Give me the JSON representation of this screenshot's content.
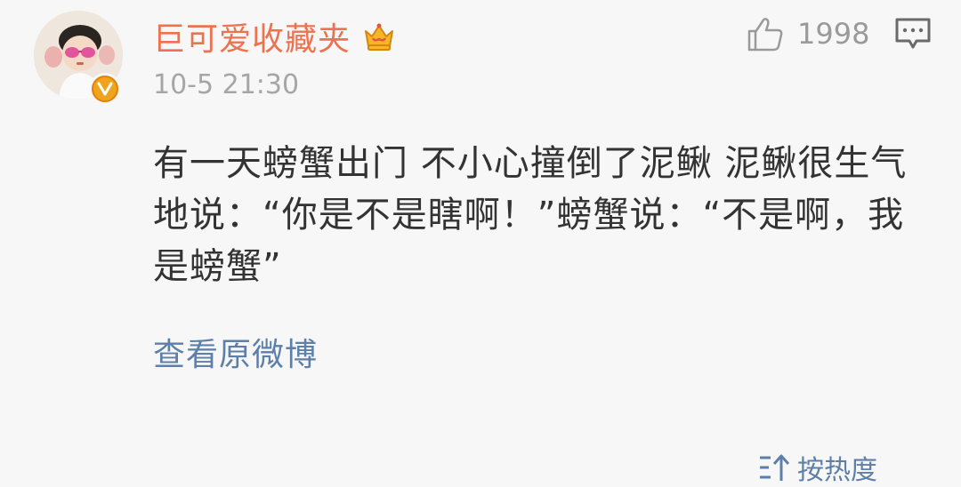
{
  "comment": {
    "username": "巨可爱收藏夹",
    "timestamp": "10-5 21:30",
    "like_count": "1998",
    "text": "有一天螃蟹出门 不小心撞倒了泥鳅 泥鳅很生气地说：“你是不是瞎啊！”螃蟹说：“不是啊，我是螃蟹”",
    "view_original_label": "查看原微博"
  },
  "footer": {
    "sort_label": "按热度"
  },
  "icons": {
    "avatar": "avatar",
    "verified": "verified-v-icon",
    "membership": "crown-icon",
    "like": "thumbs-up-icon",
    "reply": "comment-bubble-icon",
    "sort": "sort-icon"
  },
  "colors": {
    "username": "#eb7350",
    "link": "#5d7fa8",
    "text": "#333333",
    "muted": "#a6a6a6",
    "badge": "#f0a41d"
  }
}
